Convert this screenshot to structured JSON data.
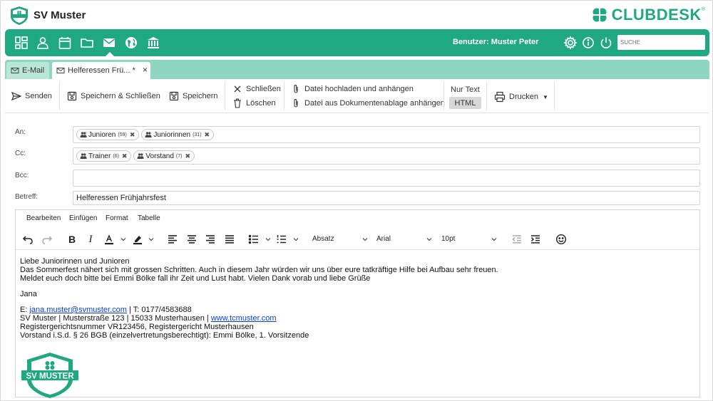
{
  "header": {
    "club_name": "SV Muster",
    "brand": "CLUBDESK",
    "brand_mark": "®"
  },
  "nav": {
    "user_label": "Benutzer: Muster Peter",
    "search_placeholder": "SUCHE",
    "icons": [
      "dashboard-icon",
      "person-icon",
      "calendar-icon",
      "folder-icon",
      "mail-icon",
      "globe-icon",
      "bank-icon"
    ]
  },
  "tabs": [
    {
      "label": "E-Mail"
    },
    {
      "label": "Helferessen Frü...",
      "modified": "*",
      "close": "×"
    }
  ],
  "toolbar": {
    "send": "Senden",
    "save_close": "Speichern & Schließen",
    "save": "Speichern",
    "close": "Schließen",
    "delete": "Löschen",
    "upload": "Datei hochladen und anhängen",
    "attach_doc": "Datei aus Dokumentenablage anhängen",
    "plain_text": "Nur Text",
    "html": "HTML",
    "print": "Drucken"
  },
  "form": {
    "to_label": "An:",
    "cc_label": "Cc:",
    "bcc_label": "Bcc:",
    "subject_label": "Betreff:",
    "to": [
      {
        "name": "Junioren",
        "count": "(59)"
      },
      {
        "name": "Juniorinnen",
        "count": "(31)"
      }
    ],
    "cc": [
      {
        "name": "Trainer",
        "count": "(6)"
      },
      {
        "name": "Vorstand",
        "count": "(7)"
      }
    ],
    "subject": "Helferessen Frühjahrsfest"
  },
  "editor": {
    "menu": [
      "Bearbeiten",
      "Einfügen",
      "Format",
      "Tabelle"
    ],
    "block_format": "Absatz",
    "font": "Arial",
    "size": "10pt",
    "body": {
      "line1": "Liebe Juniorinnen und Junioren",
      "line2": "Das Sommerfest nähert sich mit grossen Schritten. Auch in diesem Jahr würden wir uns über eure tatkräftige Hilfe bei Aufbau sehr freuen.",
      "line3": "Meldet euch doch bitte bei Emmi Bölke fall ihr Zeit und Lust habt. Vielen Dank vorab und liebe Grüße",
      "greeting": "Jana",
      "email_prefix": "E: ",
      "email": "jana.muster@svmuster.com",
      "phone": " | T: 0177/4583688",
      "address": "SV Muster | Musterstraße 123 | 15033 Musterhausen | ",
      "website": "www.tcmuster.com",
      "register": "Registergerichtsnummer VR123456, Registergericht Musterhausen",
      "board": "Vorstand i.S.d. § 26 BGB (einzelvertretungsberechtigt):  Emmi Bölke, 1. Vorsitzende",
      "logo_text": "SV MUSTER"
    }
  },
  "colors": {
    "accent": "#1fa882",
    "tab_strip": "#8fd6c0",
    "link": "#0b3fd8"
  }
}
